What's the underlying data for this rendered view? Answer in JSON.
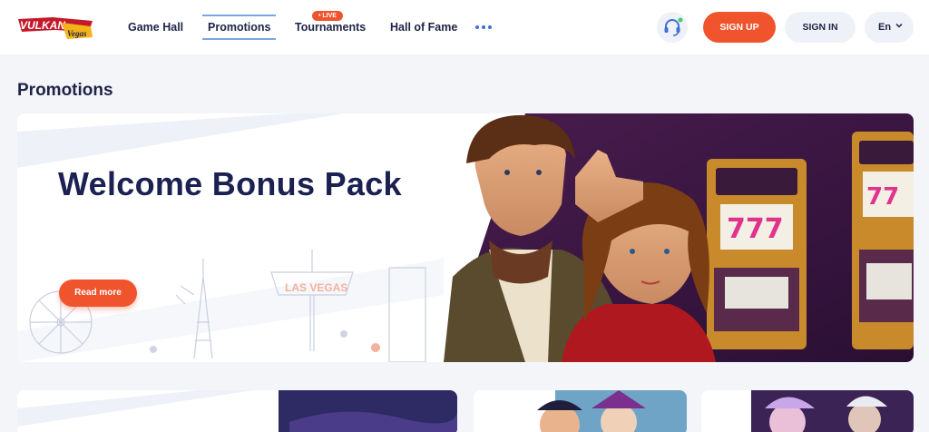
{
  "header": {
    "logo": {
      "text": "VULKAN",
      "subtext": "Vegas"
    },
    "nav": [
      {
        "label": "Game Hall"
      },
      {
        "label": "Promotions"
      },
      {
        "label": "Tournaments",
        "badge": "• LIVE"
      },
      {
        "label": "Hall of Fame"
      }
    ],
    "more_icon": "dots-icon",
    "support_icon": "headset-icon",
    "signup_label": "SIGN UP",
    "signin_label": "SIGN IN",
    "language": "En"
  },
  "page": {
    "title": "Promotions"
  },
  "banner": {
    "title": "Welcome Bonus Pack",
    "read_more": "Read more",
    "sign_text": "LAS VEGAS"
  },
  "colors": {
    "accent": "#f0542d",
    "navy": "#1e2347",
    "link_blue": "#3d6fd6"
  }
}
